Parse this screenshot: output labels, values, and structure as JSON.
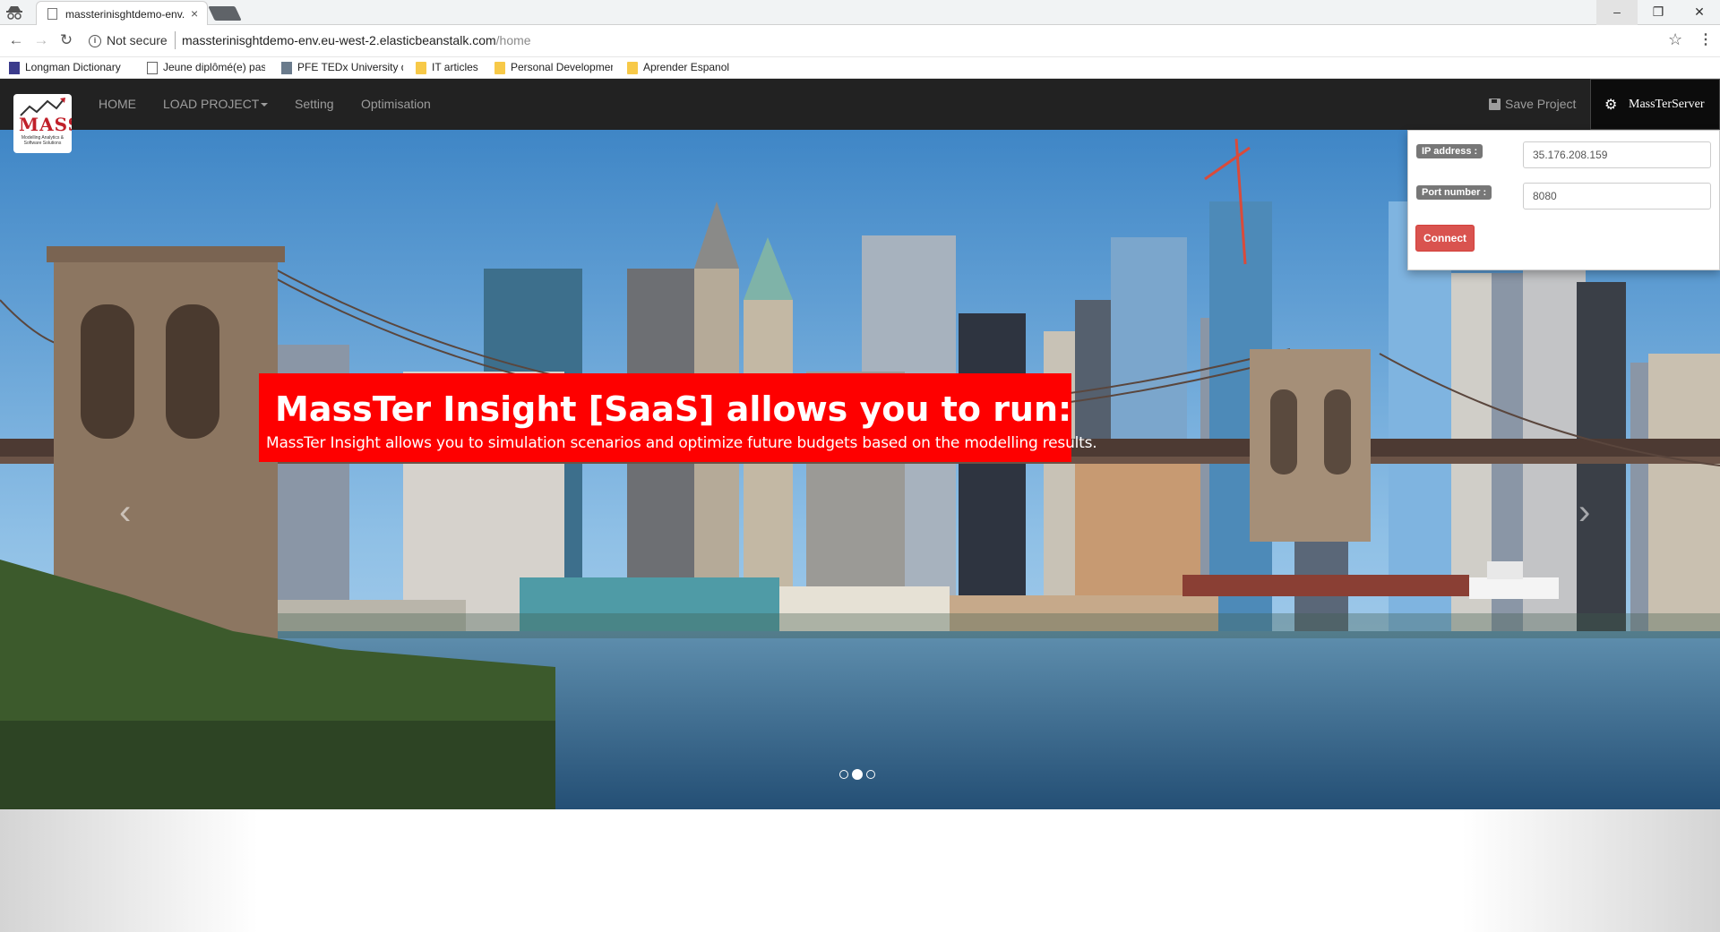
{
  "browser": {
    "tab_title": "massterinisghtdemo-env.",
    "tab_close": "×",
    "window_min": "–",
    "window_max": "❐",
    "window_close": "✕",
    "security_label": "Not secure",
    "url_host": "massterinisghtdemo-env.eu-west-2.elasticbeanstalk.com",
    "url_path": "/home",
    "bookmarks": [
      {
        "label": "Longman Dictionary",
        "icon": "longman-icon"
      },
      {
        "label": "Jeune diplômé(e) pas",
        "icon": "page-icon"
      },
      {
        "label": "PFE TEDx University d",
        "icon": "image-icon"
      },
      {
        "label": "IT articles",
        "icon": "folder-icon"
      },
      {
        "label": "Personal Developmen",
        "icon": "folder-icon"
      },
      {
        "label": "Aprender Espanol",
        "icon": "folder-icon"
      }
    ]
  },
  "app": {
    "logo_text": "MASS",
    "logo_subtitle": "Modelling Analytics & Software Solutions",
    "nav": {
      "home": "HOME",
      "load_project": "LOAD PROJECT",
      "setting": "Setting",
      "optimisation": "Optimisation",
      "save_project": "Save Project",
      "server_button": "MassTerServer"
    },
    "server_panel": {
      "ip_label": "IP address :",
      "ip_value": "35.176.208.159",
      "port_label": "Port number :",
      "port_value": "8080",
      "connect_label": "Connect"
    },
    "carousel": {
      "caption_title": "MassTer Insight [SaaS] allows you to run:",
      "caption_text": "MassTer Insight allows you to simulation scenarios and optimize future budgets based on the modelling results.",
      "prev": "‹",
      "next": "›",
      "slide_count": 3,
      "active_slide": 2
    },
    "colors": {
      "navbar_bg": "#222222",
      "caption_bg": "#fe0000",
      "connect_bg": "#d9534f"
    }
  }
}
